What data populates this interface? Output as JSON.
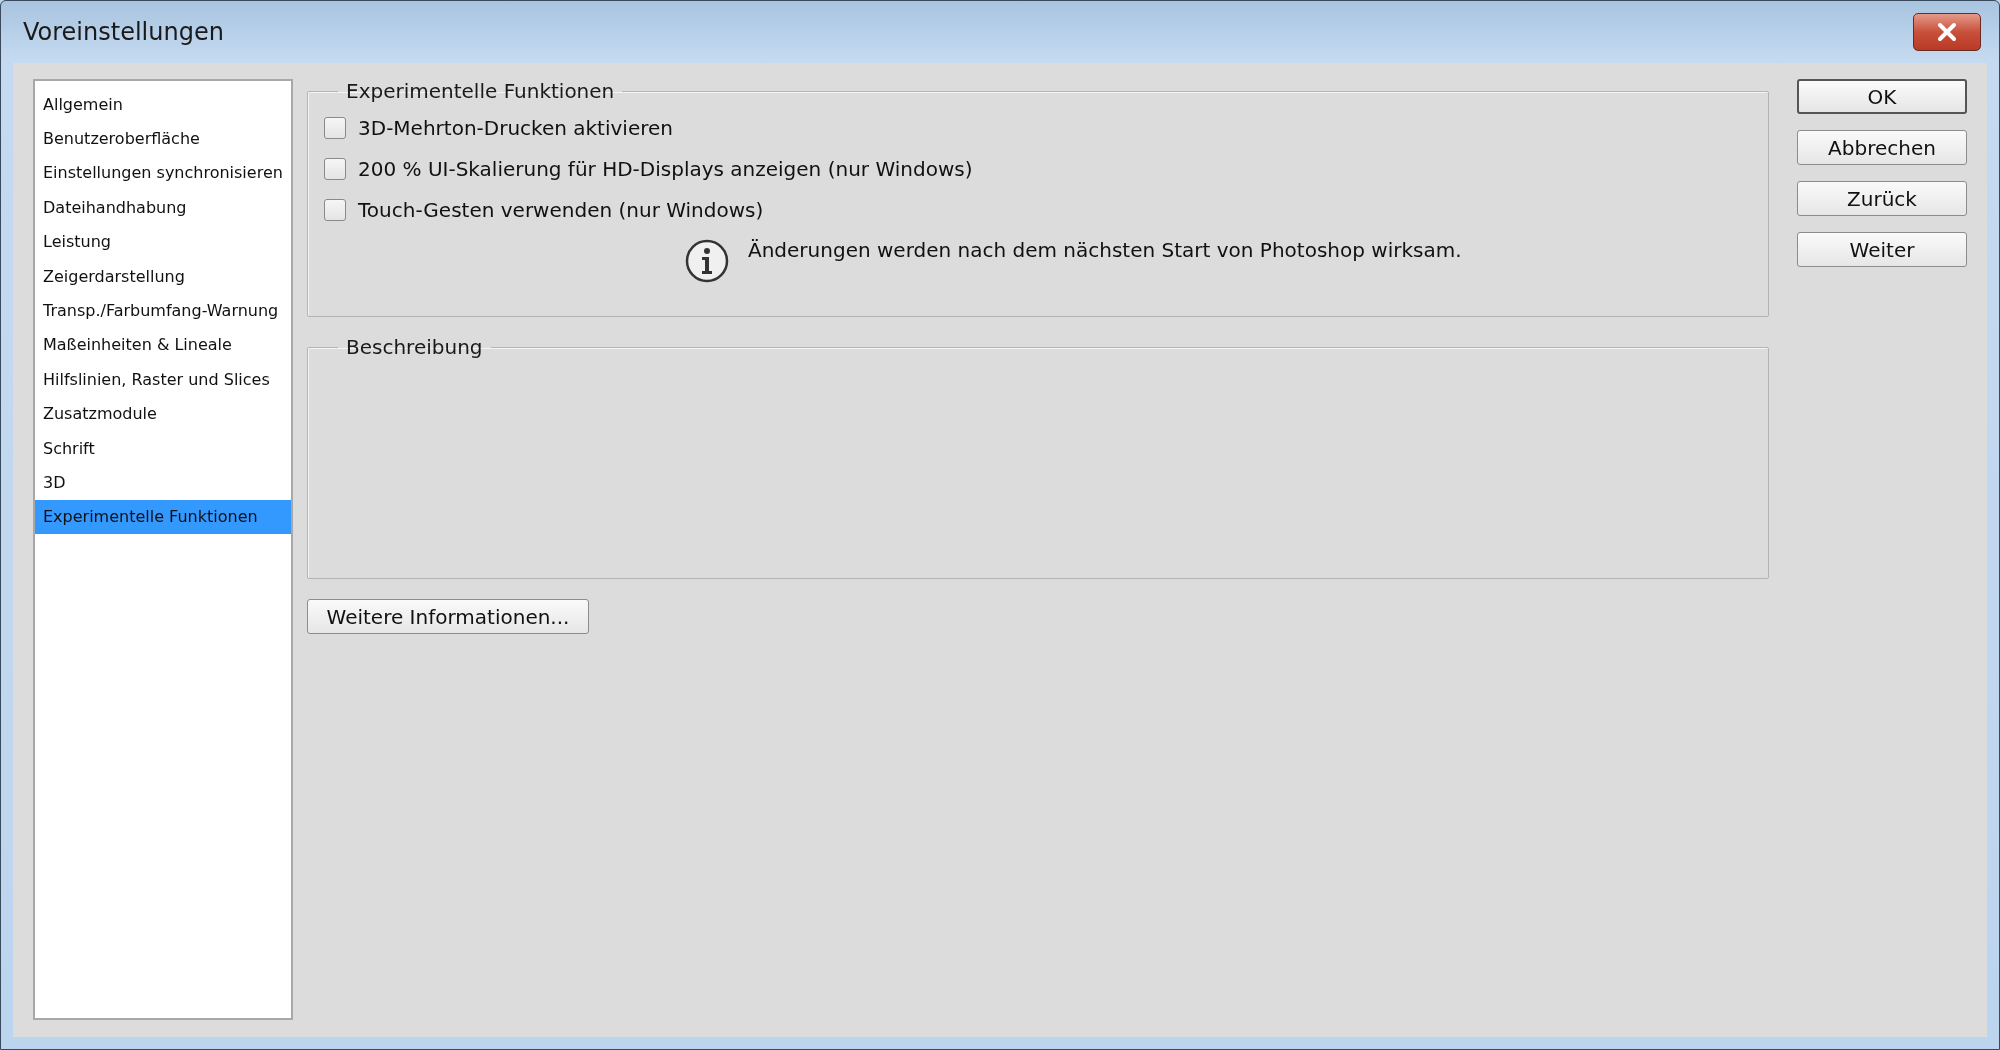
{
  "window": {
    "title": "Voreinstellungen"
  },
  "sidebar": {
    "items": [
      {
        "label": "Allgemein",
        "selected": false
      },
      {
        "label": "Benutzeroberfläche",
        "selected": false
      },
      {
        "label": "Einstellungen synchronisieren",
        "selected": false
      },
      {
        "label": "Dateihandhabung",
        "selected": false
      },
      {
        "label": "Leistung",
        "selected": false
      },
      {
        "label": "Zeigerdarstellung",
        "selected": false
      },
      {
        "label": "Transp./Farbumfang-Warnung",
        "selected": false
      },
      {
        "label": "Maßeinheiten & Lineale",
        "selected": false
      },
      {
        "label": "Hilfslinien, Raster und Slices",
        "selected": false
      },
      {
        "label": "Zusatzmodule",
        "selected": false
      },
      {
        "label": "Schrift",
        "selected": false
      },
      {
        "label": "3D",
        "selected": false
      },
      {
        "label": "Experimentelle Funktionen",
        "selected": true
      }
    ]
  },
  "experimental": {
    "title": "Experimentelle Funktionen",
    "options": [
      {
        "label": "3D-Mehrton-Drucken aktivieren",
        "checked": false
      },
      {
        "label": "200 % UI-Skalierung für HD-Displays anzeigen (nur Windows)",
        "checked": false
      },
      {
        "label": "Touch-Gesten verwenden (nur Windows)",
        "checked": false
      }
    ],
    "notice": "Änderungen werden nach dem nächsten Start von Photoshop wirksam."
  },
  "description": {
    "title": "Beschreibung"
  },
  "more_info_button": "Weitere Informationen...",
  "buttons": [
    {
      "label": "OK",
      "default": true
    },
    {
      "label": "Abbrechen",
      "default": false
    },
    {
      "label": "Zurück",
      "default": false
    },
    {
      "label": "Weiter",
      "default": false
    }
  ]
}
